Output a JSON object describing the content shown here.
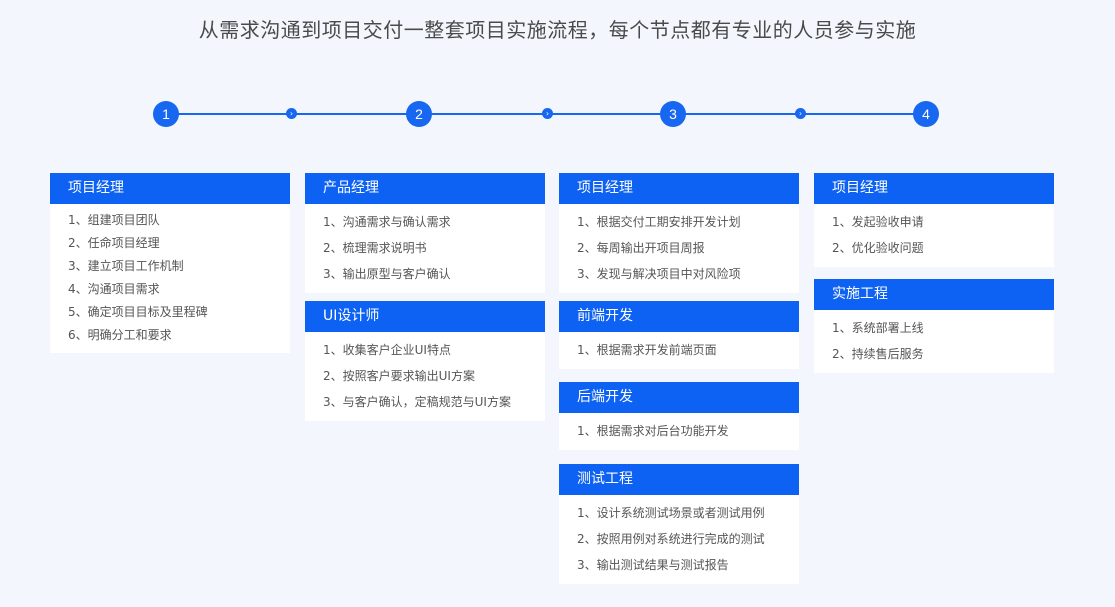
{
  "headline": "从需求沟通到项目交付一整套项目实施流程，每个节点都有专业的人员参与实施",
  "steps": [
    "1",
    "2",
    "3",
    "4"
  ],
  "connector_glyph": "›",
  "colors": {
    "accent": "#0d62f4",
    "background": "#f3f7fd",
    "card": "#ffffff",
    "text": "#555555"
  },
  "columns": [
    {
      "cards": [
        {
          "title": "项目经理",
          "items": [
            "1、组建项目团队",
            "2、任命项目经理",
            "3、建立项目工作机制",
            "4、沟通项目需求",
            "5、确定项目目标及里程碑",
            "6、明确分工和要求"
          ]
        }
      ]
    },
    {
      "cards": [
        {
          "title": "产品经理",
          "items": [
            "1、沟通需求与确认需求",
            "2、梳理需求说明书",
            "3、输出原型与客户确认"
          ]
        },
        {
          "title": "UI设计师",
          "items": [
            "1、收集客户企业UI特点",
            "2、按照客户要求输出UI方案",
            "3、与客户确认，定稿规范与UI方案"
          ]
        }
      ]
    },
    {
      "cards": [
        {
          "title": "项目经理",
          "items": [
            "1、根据交付工期安排开发计划",
            "2、每周输出开项目周报",
            "3、发现与解决项目中对风险项"
          ]
        },
        {
          "title": "前端开发",
          "items": [
            "1、根据需求开发前端页面"
          ]
        },
        {
          "title": "后端开发",
          "items": [
            "1、根据需求对后台功能开发"
          ]
        },
        {
          "title": "测试工程",
          "items": [
            "1、设计系统测试场景或者测试用例",
            "2、按照用例对系统进行完成的测试",
            "3、输出测试结果与测试报告"
          ]
        }
      ]
    },
    {
      "cards": [
        {
          "title": "项目经理",
          "items": [
            "1、发起验收申请",
            "2、优化验收问题"
          ]
        },
        {
          "title": "实施工程",
          "items": [
            "1、系统部署上线",
            "2、持续售后服务"
          ]
        }
      ]
    }
  ]
}
